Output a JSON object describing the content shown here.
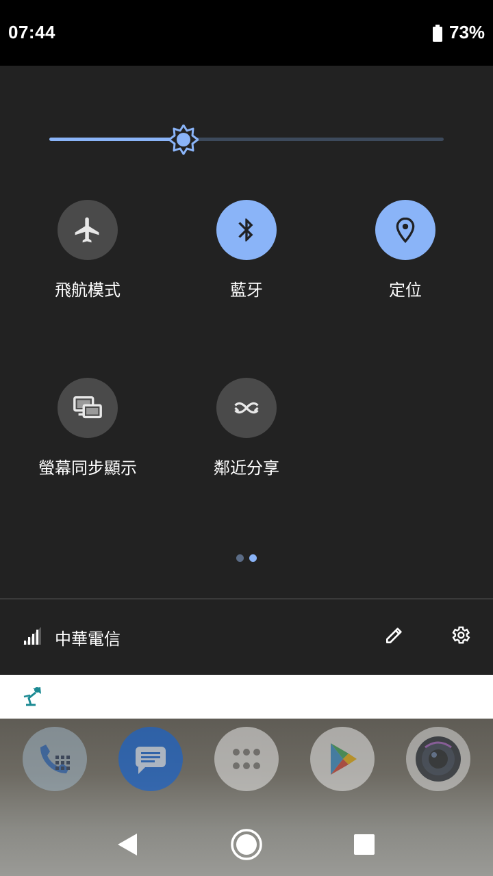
{
  "status_bar": {
    "time": "07:44",
    "battery_percent": "73%",
    "battery_icon": "battery-icon"
  },
  "quick_settings": {
    "brightness": {
      "level": 0.34,
      "icon": "brightness-icon"
    },
    "tiles": [
      {
        "label": "飛航模式",
        "icon": "airplane-icon",
        "active": false
      },
      {
        "label": "藍牙",
        "icon": "bluetooth-icon",
        "active": true
      },
      {
        "label": "定位",
        "icon": "location-icon",
        "active": true
      },
      {
        "label": "螢幕同步顯示",
        "icon": "cast-screen-icon",
        "active": false
      },
      {
        "label": "鄰近分享",
        "icon": "nearby-share-icon",
        "active": false
      }
    ],
    "pager": {
      "pages": 2,
      "current": 2
    },
    "footer": {
      "carrier": "中華電信",
      "signal_icon": "signal-icon",
      "edit_icon": "edit-icon",
      "settings_icon": "gear-icon"
    }
  },
  "notification": {
    "icon": "lamp-icon"
  },
  "dock": [
    {
      "icon": "phone-icon"
    },
    {
      "icon": "messages-icon"
    },
    {
      "icon": "app-drawer-icon"
    },
    {
      "icon": "play-store-icon"
    },
    {
      "icon": "camera-icon"
    }
  ],
  "nav": {
    "back": "back-icon",
    "home": "home-icon",
    "recents": "recents-icon"
  },
  "colors": {
    "accent": "#8ab4f8",
    "panel": "#222222",
    "tile_off": "#4a4a4a"
  }
}
